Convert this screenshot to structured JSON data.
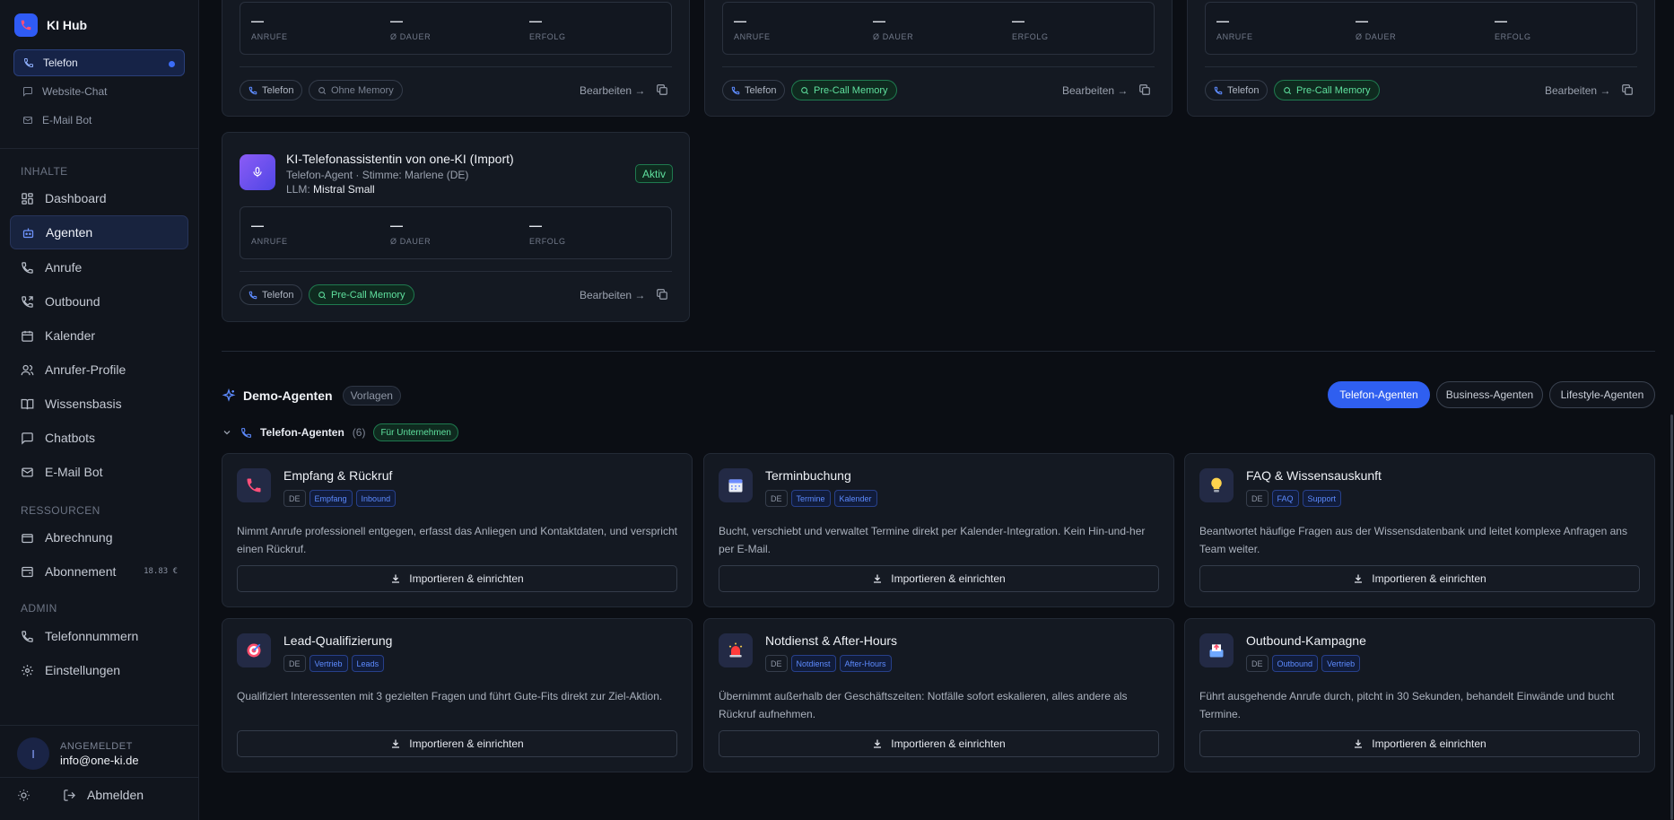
{
  "app": {
    "name": "KI Hub"
  },
  "channels": [
    {
      "label": "Telefon",
      "icon": "phone-icon",
      "active": true
    },
    {
      "label": "Website-Chat",
      "icon": "chat-icon",
      "active": false
    },
    {
      "label": "E-Mail Bot",
      "icon": "mail-icon",
      "active": false
    }
  ],
  "sections": {
    "inhalte": "INHALTE",
    "ressourcen": "RESSOURCEN",
    "admin": "ADMIN"
  },
  "nav": {
    "inhalte": [
      {
        "label": "Dashboard",
        "icon": "grid-icon"
      },
      {
        "label": "Agenten",
        "icon": "robot-icon",
        "active": true
      },
      {
        "label": "Anrufe",
        "icon": "phone-icon"
      },
      {
        "label": "Outbound",
        "icon": "phone-outgoing-icon"
      },
      {
        "label": "Kalender",
        "icon": "calendar-icon"
      },
      {
        "label": "Anrufer-Profile",
        "icon": "users-icon"
      },
      {
        "label": "Wissensbasis",
        "icon": "book-icon"
      },
      {
        "label": "Chatbots",
        "icon": "chat-icon"
      },
      {
        "label": "E-Mail Bot",
        "icon": "mail-icon"
      }
    ],
    "ressourcen": [
      {
        "label": "Abrechnung",
        "icon": "wallet-icon"
      },
      {
        "label": "Abonnement",
        "icon": "subscription-icon",
        "badge": "18.83 €"
      }
    ],
    "admin": [
      {
        "label": "Telefonnummern",
        "icon": "phone-icon"
      },
      {
        "label": "Einstellungen",
        "icon": "gear-icon"
      }
    ]
  },
  "user": {
    "label": "ANGEMELDET",
    "email": "info@one-ki.de",
    "initial": "I",
    "logout": "Abmelden"
  },
  "stat_labels": {
    "calls": "ANRUFE",
    "duration": "Ø DAUER",
    "success": "ERFOLG"
  },
  "agent_cards": [
    {
      "stats": [
        "—",
        "—",
        "—"
      ],
      "chips": [
        "Telefon",
        "Ohne Memory"
      ],
      "edit": "Bearbeiten →"
    },
    {
      "stats": [
        "—",
        "—",
        "—"
      ],
      "chips": [
        "Telefon",
        "Pre-Call Memory"
      ],
      "edit": "Bearbeiten →"
    },
    {
      "stats": [
        "—",
        "—",
        "—"
      ],
      "chips": [
        "Telefon",
        "Pre-Call Memory"
      ],
      "edit": "Bearbeiten →"
    },
    {
      "title": "KI-Telefonassistentin von one-KI (Import)",
      "subtitle": "Telefon-Agent · Stimme: Marlene (DE)",
      "llm_label": "LLM:",
      "llm": "Mistral Small",
      "status": "Aktiv",
      "stats": [
        "—",
        "—",
        "—"
      ],
      "chips": [
        "Telefon",
        "Pre-Call Memory"
      ],
      "edit": "Bearbeiten →"
    }
  ],
  "demo": {
    "title": "Demo-Agenten",
    "tag": "Vorlagen",
    "tabs": [
      "Telefon-Agenten",
      "Business-Agenten",
      "Lifestyle-Agenten"
    ],
    "group": {
      "title": "Telefon-Agenten",
      "count": "(6)",
      "tag": "Für Unternehmen"
    },
    "import_label": "Importieren & einrichten",
    "cards": [
      {
        "title": "Empfang & Rückruf",
        "icon": "phone-icon",
        "lang": "DE",
        "tags": [
          "Empfang",
          "Inbound"
        ],
        "desc": "Nimmt Anrufe professionell entgegen, erfasst das Anliegen und Kontaktdaten, und verspricht einen Rückruf."
      },
      {
        "title": "Terminbuchung",
        "icon": "calendar-icon",
        "lang": "DE",
        "tags": [
          "Termine",
          "Kalender"
        ],
        "desc": "Bucht, verschiebt und verwaltet Termine direkt per Kalender-Integration. Kein Hin-und-her per E-Mail."
      },
      {
        "title": "FAQ & Wissensauskunft",
        "icon": "lightbulb-icon",
        "lang": "DE",
        "tags": [
          "FAQ",
          "Support"
        ],
        "desc": "Beantwortet häufige Fragen aus der Wissensdatenbank und leitet komplexe Anfragen ans Team weiter."
      },
      {
        "title": "Lead-Qualifizierung",
        "icon": "target-icon",
        "lang": "DE",
        "tags": [
          "Vertrieb",
          "Leads"
        ],
        "desc": "Qualifiziert Interessenten mit 3 gezielten Fragen und führt Gute-Fits direkt zur Ziel-Aktion."
      },
      {
        "title": "Notdienst & After-Hours",
        "icon": "siren-icon",
        "lang": "DE",
        "tags": [
          "Notdienst",
          "After-Hours"
        ],
        "desc": "Übernimmt außerhalb der Geschäftszeiten: Notfälle sofort eskalieren, alles andere als Rückruf aufnehmen."
      },
      {
        "title": "Outbound-Kampagne",
        "icon": "outbox-icon",
        "lang": "DE",
        "tags": [
          "Outbound",
          "Vertrieb"
        ],
        "desc": "Führt ausgehende Anrufe durch, pitcht in 30 Sekunden, behandelt Einwände und bucht Termine."
      }
    ]
  },
  "colors": {
    "accent": "#2f5ff0",
    "green": "#5fe09e",
    "bg": "#0b0e14"
  }
}
